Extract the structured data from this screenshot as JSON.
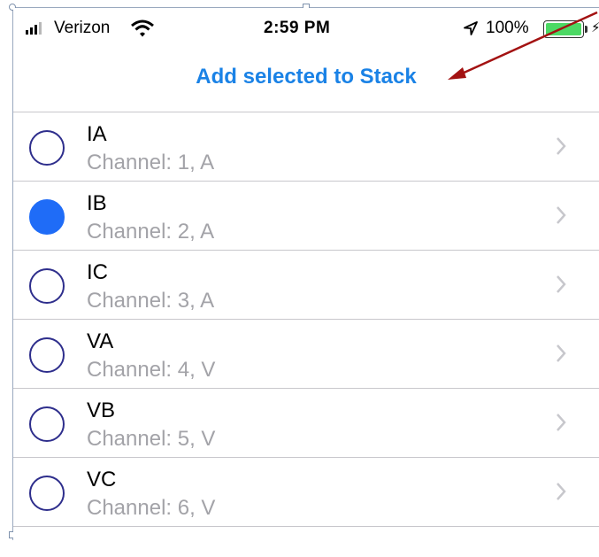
{
  "status_bar": {
    "carrier": "Verizon",
    "time": "2:59 PM",
    "battery": "100%",
    "signal_icon": "signal-bars-icon",
    "wifi_icon": "wifi-icon",
    "location_icon": "location-arrow-icon",
    "battery_icon": "battery-icon",
    "charging_icon": "lightning-bolt-icon"
  },
  "nav": {
    "action_label": "Add selected to Stack"
  },
  "colors": {
    "accent": "#1a82e6",
    "radio_selected": "#1f6cf7",
    "radio_border": "#2e2e8c",
    "annotation_arrow": "#a31212",
    "battery_fill": "#4cd964"
  },
  "channels": [
    {
      "title": "IA",
      "subtitle": "Channel: 1, A",
      "selected": false
    },
    {
      "title": "IB",
      "subtitle": "Channel: 2, A",
      "selected": true
    },
    {
      "title": "IC",
      "subtitle": "Channel: 3, A",
      "selected": false
    },
    {
      "title": "VA",
      "subtitle": "Channel: 4, V",
      "selected": false
    },
    {
      "title": "VB",
      "subtitle": "Channel: 5, V",
      "selected": false
    },
    {
      "title": "VC",
      "subtitle": "Channel: 6, V",
      "selected": false
    }
  ]
}
